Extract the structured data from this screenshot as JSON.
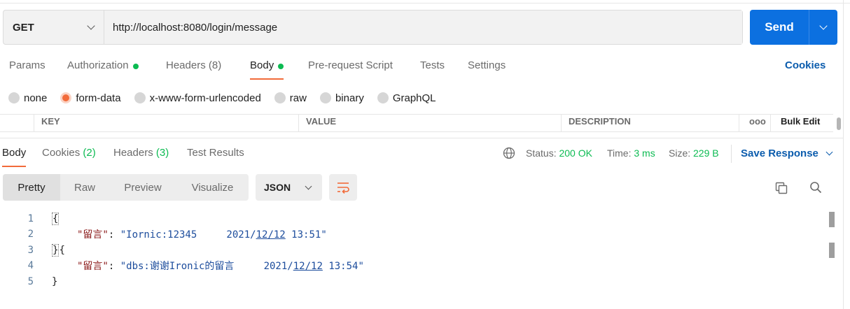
{
  "request": {
    "method": "GET",
    "url": "http://localhost:8080/login/message",
    "send_label": "Send"
  },
  "request_tabs": [
    {
      "label": "Params"
    },
    {
      "label": "Authorization"
    },
    {
      "label": "Headers (8)"
    },
    {
      "label": "Body"
    },
    {
      "label": "Pre-request Script"
    },
    {
      "label": "Tests"
    },
    {
      "label": "Settings"
    }
  ],
  "cookies_link": "Cookies",
  "body_types": [
    {
      "label": "none"
    },
    {
      "label": "form-data"
    },
    {
      "label": "x-www-form-urlencoded"
    },
    {
      "label": "raw"
    },
    {
      "label": "binary"
    },
    {
      "label": "GraphQL"
    }
  ],
  "kv_table": {
    "key": "KEY",
    "value": "VALUE",
    "description": "DESCRIPTION",
    "more": "ooo",
    "bulk_edit": "Bulk Edit"
  },
  "response_tabs": {
    "body": "Body",
    "cookies": "Cookies",
    "cookies_count": "(2)",
    "headers": "Headers",
    "headers_count": "(3)",
    "test_results": "Test Results"
  },
  "response_meta": {
    "status_label": "Status:",
    "status_value": "200 OK",
    "time_label": "Time:",
    "time_value": "3 ms",
    "size_label": "Size:",
    "size_value": "229 B",
    "save_response": "Save Response"
  },
  "view_modes": [
    {
      "label": "Pretty"
    },
    {
      "label": "Raw"
    },
    {
      "label": "Preview"
    },
    {
      "label": "Visualize"
    }
  ],
  "format": "JSON",
  "code": {
    "line_numbers": [
      "1",
      "2",
      "3",
      "4",
      "5"
    ],
    "line1": "{",
    "line2_key": "\"留言\"",
    "line2_colon": ": ",
    "line2_val_a": "\"Iornic:12345     2021/",
    "line2_val_ul": "12/12",
    "line2_val_b": " 13:51\"",
    "line3_a": "}",
    "line3_b": "{",
    "line4_key": "\"留言\"",
    "line4_colon": ": ",
    "line4_val_a": "\"dbs:谢谢Ironic的留言     2021/",
    "line4_val_ul": "12/12",
    "line4_val_b": " 13:54\"",
    "line5": "}"
  }
}
